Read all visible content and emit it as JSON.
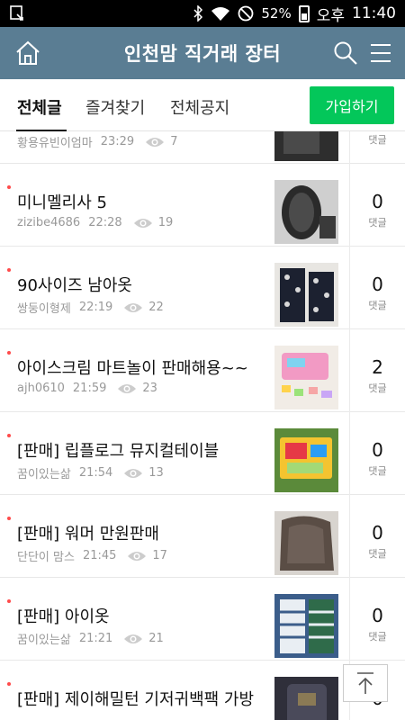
{
  "status_bar": {
    "battery": "52%",
    "ampm": "오후",
    "time": "11:40",
    "icons": [
      "notification-icon",
      "bluetooth-icon",
      "wifi-icon",
      "dnd-icon",
      "battery-icon"
    ]
  },
  "app_bar": {
    "title": "인천맘 직거래 장터",
    "background": "#5a7d93"
  },
  "tabs": {
    "items": [
      "전체글",
      "즐겨찾기",
      "전체공지"
    ],
    "active": "전체글",
    "join_label": "가입하기",
    "join_color": "#03c75a"
  },
  "posts": [
    {
      "title": "",
      "author": "황용유빈이엄마",
      "time": "23:29",
      "views": "7",
      "comments": "",
      "comment_label": "댓글"
    },
    {
      "title": "미니멜리사 5",
      "author": "zizibe4686",
      "time": "22:28",
      "views": "19",
      "comments": "0",
      "comment_label": "댓글"
    },
    {
      "title": "90사이즈 남아옷",
      "author": "쌍둥이형제",
      "time": "22:19",
      "views": "22",
      "comments": "0",
      "comment_label": "댓글"
    },
    {
      "title": "아이스크림 마트놀이 판매해용~~",
      "author": "ajh0610",
      "time": "21:59",
      "views": "23",
      "comments": "2",
      "comment_label": "댓글"
    },
    {
      "title": "[판매] 립플로그 뮤지컬테이블",
      "author": "꿈이있는삶",
      "time": "21:54",
      "views": "13",
      "comments": "0",
      "comment_label": "댓글"
    },
    {
      "title": "[판매] 워머 만원판매",
      "author": "단단이 맘스",
      "time": "21:45",
      "views": "17",
      "comments": "0",
      "comment_label": "댓글"
    },
    {
      "title": "[판매] 아이옷",
      "author": "꿈이있는삶",
      "time": "21:21",
      "views": "21",
      "comments": "0",
      "comment_label": "댓글"
    },
    {
      "title": "[판매] 제이해밀턴 기저귀백팩 가방",
      "author": "",
      "time": "",
      "views": "",
      "comments": "0",
      "comment_label": ""
    }
  ]
}
